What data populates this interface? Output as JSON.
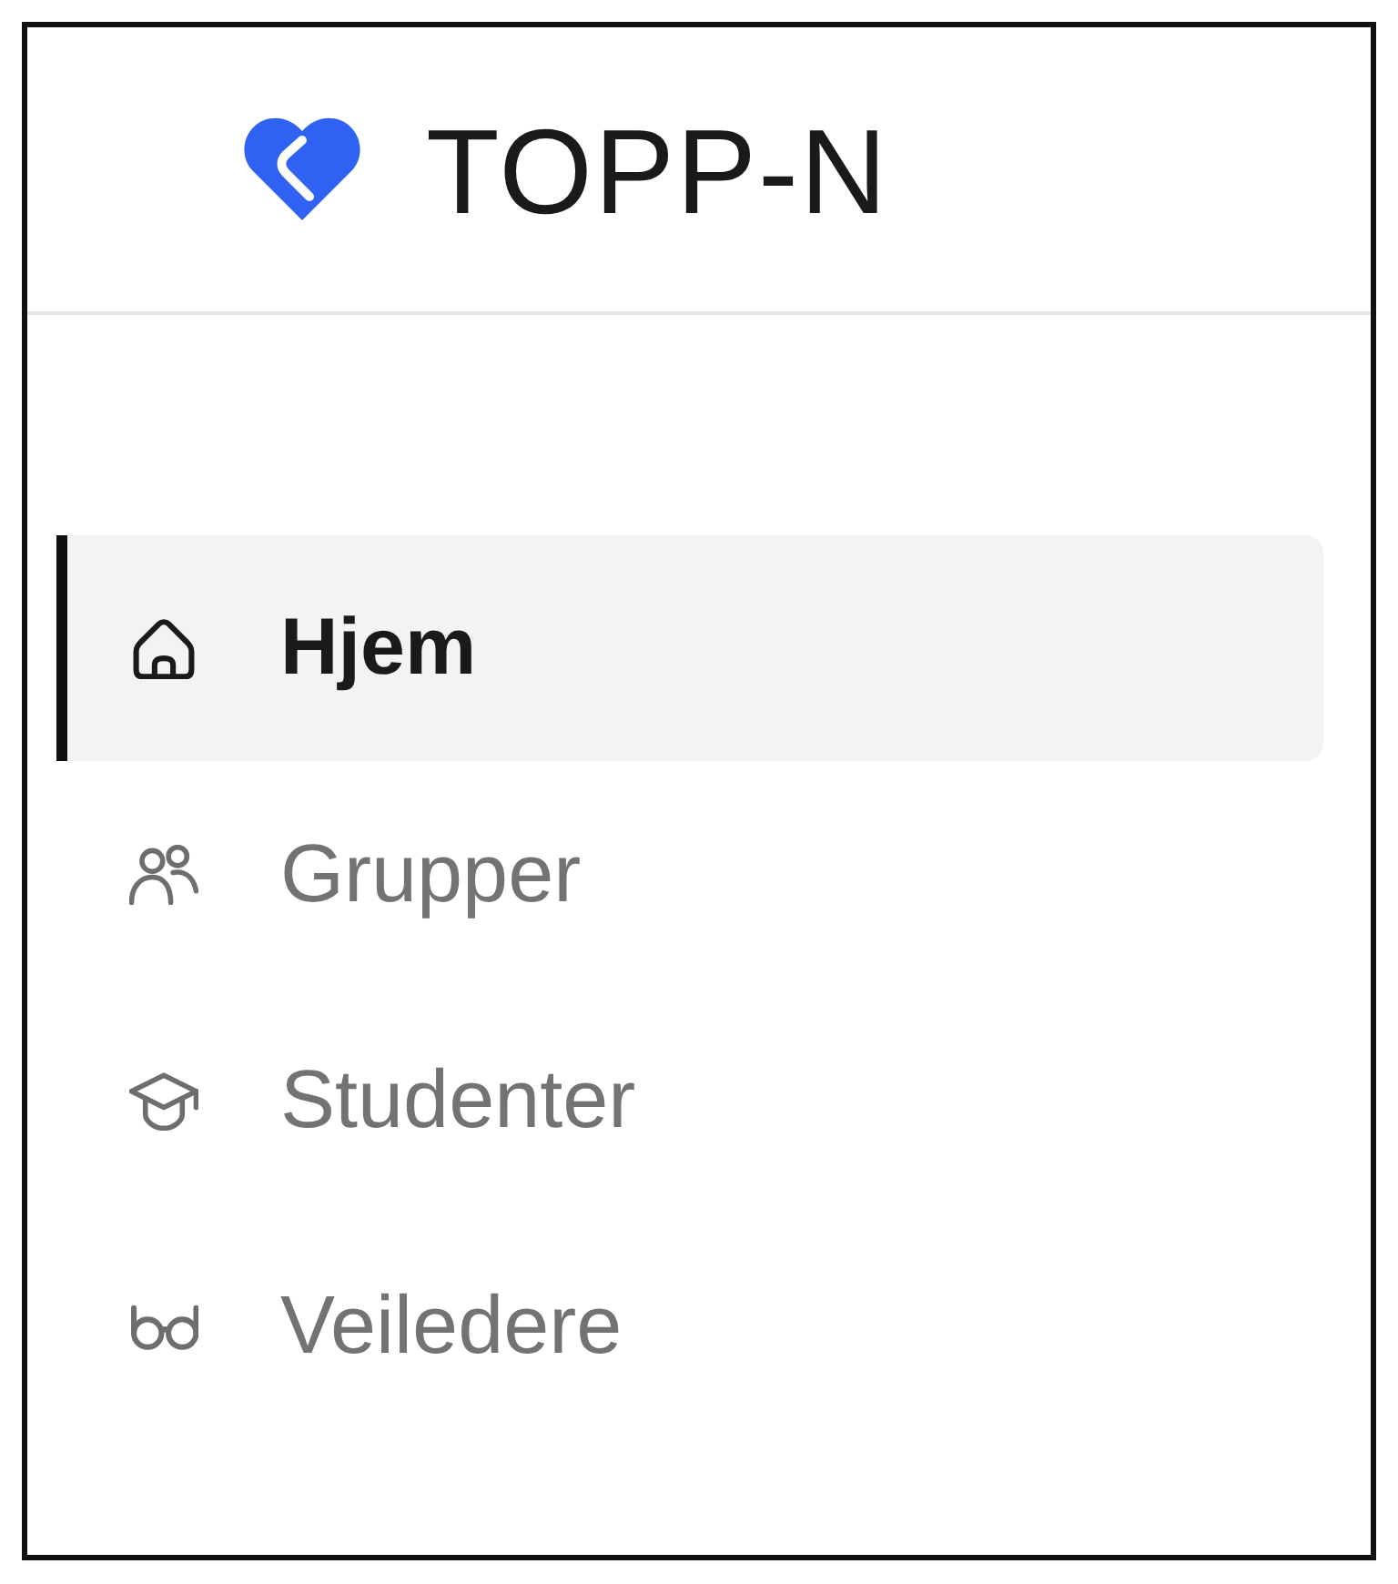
{
  "app": {
    "name": "TOPP-N"
  },
  "nav": [
    {
      "label": "Hjem",
      "selected": true
    },
    {
      "label": "Grupper",
      "selected": false
    },
    {
      "label": "Studenter",
      "selected": false
    },
    {
      "label": "Veiledere",
      "selected": false
    }
  ]
}
